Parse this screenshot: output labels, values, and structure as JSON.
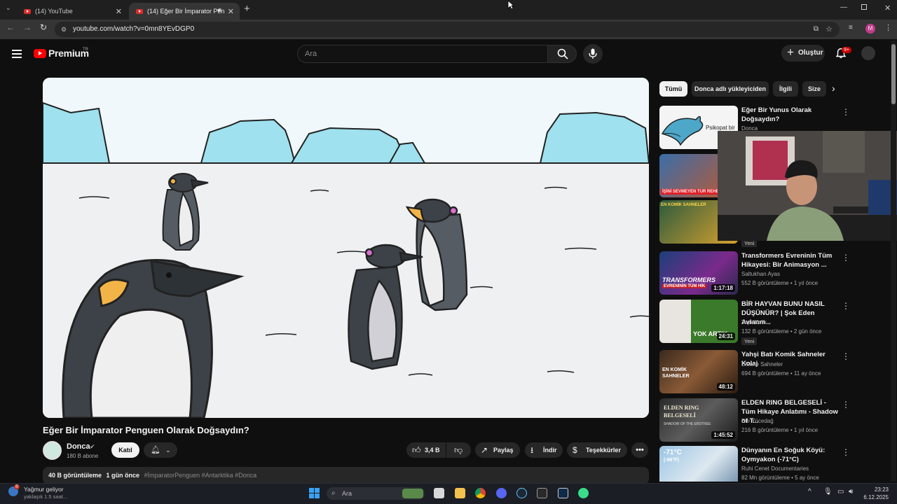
{
  "browser": {
    "tabs": [
      {
        "label": "(14) YouTube"
      },
      {
        "label": "(14) Eğer Bir İmparator Pen"
      }
    ],
    "url": "youtube.com/watch?v=0mn8YEvDGP0"
  },
  "header": {
    "logo": "Premium",
    "logo_region": "TR",
    "search_placeholder": "Ara",
    "create_label": "Oluştur",
    "notifications": "9+",
    "avatar_initial": "M"
  },
  "video": {
    "title": "Eğer Bir İmparator Penguen Olarak Doğsaydın?",
    "channel": "Donca",
    "subscribers": "180 B abone",
    "join_label": "Katıl",
    "likes": "3,4 B",
    "share_label": "Paylaş",
    "download_label": "İndir",
    "thanks_label": "Teşekkürler",
    "views": "40 B görüntüleme",
    "age": "1 gün önce",
    "tags": "#İmparatorPenguen #Antarktika #Donca"
  },
  "chips": [
    "Tümü",
    "Donca adlı yükleyiciden",
    "İlgili",
    "Size"
  ],
  "recommendations": [
    {
      "title": "Eğer Bir Yunus Olarak Doğsaydın?",
      "channel": "Donca",
      "meta": "",
      "duration": "",
      "new": ""
    },
    {
      "title": "",
      "channel": "",
      "meta": "",
      "duration": "",
      "new": "Yeni"
    },
    {
      "title": "Transformers Evreninin Tüm Hikayesi: Bir Animasyon ...",
      "channel": "Saltukhan Ayas",
      "meta": "552 B görüntüleme • 1 yıl önce",
      "duration": "1:17:18",
      "new": ""
    },
    {
      "title": "BİR HAYVAN BUNU NASIL DÜŞÜNÜR? | Şok Eden Avlanm...",
      "channel": "TepkiKolik",
      "meta": "132 B görüntüleme • 2 gün önce",
      "duration": "24:31",
      "new": "Yeni"
    },
    {
      "title": "Yahşi Batı Komik Sahneler Kolaj",
      "channel": "Efsane Sahneler",
      "meta": "694 B görüntüleme • 11 ay önce",
      "duration": "48:12",
      "new": ""
    },
    {
      "title": "ELDEN RING BELGESELİ - Tüm Hikaye Anlatımı - Shadow of T...",
      "channel": "Efe Yücedağ",
      "meta": "216 B görüntüleme • 1 yıl önce",
      "duration": "1:45:52",
      "new": ""
    },
    {
      "title": "Dünyanın En Soğuk Köyü: Oymyakon (-71°C)",
      "channel": "Ruhi Cenet Documentaries",
      "meta": "82 Mn görüntüleme • 5 ay önce",
      "duration": "",
      "new": ""
    }
  ],
  "thumb_text": {
    "transformers": "TRANSFORMERS",
    "transformers_sub": "EVRENİNİN TÜM HİK",
    "animal": "YOK ARTIK",
    "western": "EN KOMİK SAHNELER",
    "elden": "ELDEN RING BELGESELİ",
    "elden_sub": "SHADOW OF THE ERDTREE",
    "cold": "-71°C",
    "cold_sub": "(-96°F)",
    "clip1": "İŞİNİ SEVMEYEN TUR REHBERİ",
    "clip2": "EN KOMİK SAHNELER",
    "dolphin_text": "Psikopat bir"
  },
  "taskbar": {
    "weather": "Yağmur geliyor",
    "weather_sub": "yaklaşık 1.5 saat...",
    "weather_badge": "8",
    "search": "Ara",
    "time": "23:23",
    "date": "6.12.2025"
  },
  "colors": {
    "youtube_red": "#ff0000",
    "background": "#0f0f0f",
    "chip": "#272727"
  }
}
